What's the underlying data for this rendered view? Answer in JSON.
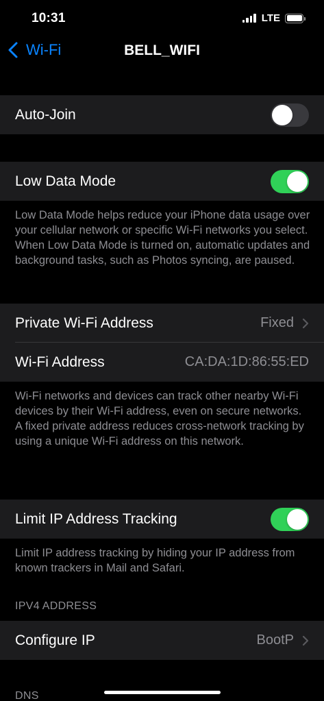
{
  "status_bar": {
    "time": "10:31",
    "network": "LTE"
  },
  "nav": {
    "back_label": "Wi-Fi",
    "title": "BELL_WIFI"
  },
  "auto_join": {
    "label": "Auto-Join",
    "enabled": false
  },
  "low_data_mode": {
    "label": "Low Data Mode",
    "enabled": true,
    "footer": "Low Data Mode helps reduce your iPhone data usage over your cellular network or specific Wi-Fi networks you select. When Low Data Mode is turned on, automatic updates and background tasks, such as Photos syncing, are paused."
  },
  "private_address": {
    "label": "Private Wi-Fi Address",
    "value": "Fixed",
    "wifi_address_label": "Wi-Fi Address",
    "wifi_address_value": "CA:DA:1D:86:55:ED",
    "footer": "Wi-Fi networks and devices can track other nearby Wi-Fi devices by their Wi-Fi address, even on secure networks.\nA fixed private address reduces cross-network tracking by using a unique Wi-Fi address on this network."
  },
  "limit_ip": {
    "label": "Limit IP Address Tracking",
    "enabled": true,
    "footer": "Limit IP address tracking by hiding your IP address from known trackers in Mail and Safari."
  },
  "ipv4": {
    "header": "IPV4 ADDRESS",
    "configure_label": "Configure IP",
    "configure_value": "BootP"
  },
  "dns": {
    "header": "DNS"
  },
  "colors": {
    "background": "#000000",
    "cell": "#1c1c1e",
    "accent": "#0a84ff",
    "toggle_on": "#30d158",
    "secondary_text": "#8e8e93"
  }
}
